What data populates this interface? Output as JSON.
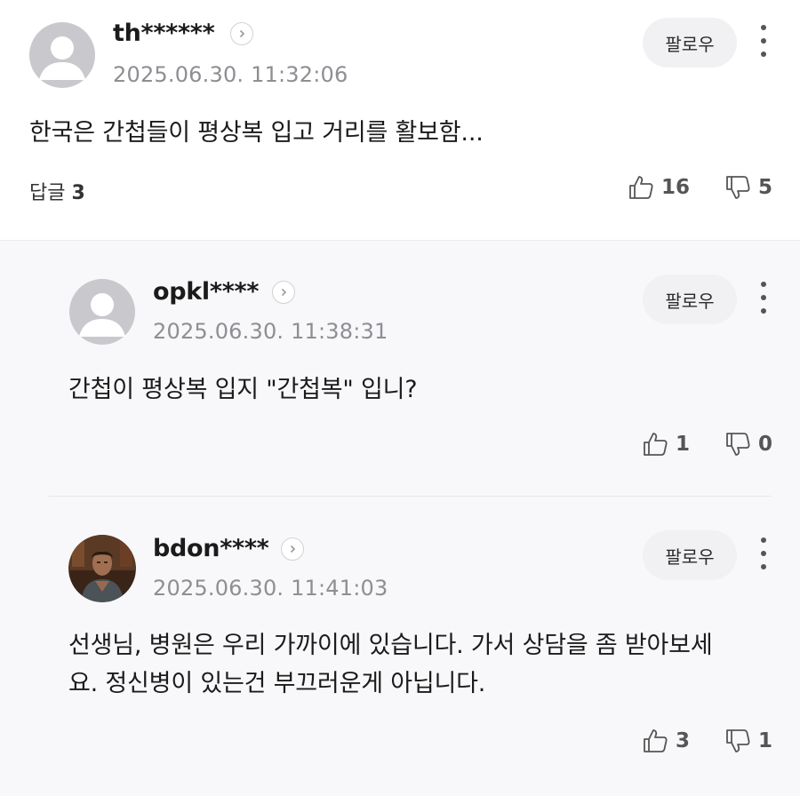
{
  "comments": [
    {
      "username": "th******",
      "timestamp": "2025.06.30. 11:32:06",
      "follow_label": "팔로우",
      "text": "한국은 간첩들이 평상복 입고 거리를 활보함...",
      "replies_label": "답글",
      "replies_count": "3",
      "likes": "16",
      "dislikes": "5"
    }
  ],
  "replies": [
    {
      "username": "opkl****",
      "timestamp": "2025.06.30. 11:38:31",
      "follow_label": "팔로우",
      "text": "간첩이 평상복 입지 \"간첩복\" 입니?",
      "likes": "1",
      "dislikes": "0"
    },
    {
      "username": "bdon****",
      "timestamp": "2025.06.30. 11:41:03",
      "follow_label": "팔로우",
      "text": "선생님, 병원은 우리 가까이에 있습니다. 가서 상담을 좀 받아보세요. 정신병이 있는건 부끄러운게 아닙니다.",
      "likes": "3",
      "dislikes": "1"
    }
  ],
  "icons": {
    "default_avatar": "default-avatar-icon",
    "profile_link": "chevron-right-icon",
    "more": "more-vertical-icon",
    "like": "thumbs-up-icon",
    "dislike": "thumbs-down-icon"
  },
  "colors": {
    "reply_background": "#f8f8fa",
    "follow_button": "#f1f1f3",
    "timestamp": "#8e8e93"
  }
}
